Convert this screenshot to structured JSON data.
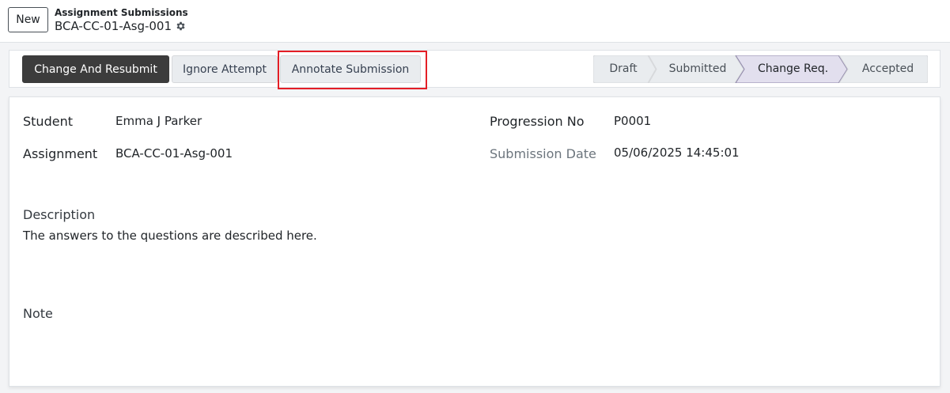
{
  "control_panel": {
    "new_label": "New",
    "breadcrumb_parent": "Assignment Submissions",
    "record_name": "BCA-CC-01-Asg-001"
  },
  "status_bar": {
    "buttons": {
      "change_resubmit": "Change And Resubmit",
      "ignore_attempt": "Ignore Attempt",
      "annotate_submission": "Annotate Submission"
    },
    "stages": [
      "Draft",
      "Submitted",
      "Change Req.",
      "Accepted"
    ],
    "active_stage": "Change Req."
  },
  "form": {
    "student_label": "Student",
    "student_value": "Emma J Parker",
    "assignment_label": "Assignment",
    "assignment_value": "BCA-CC-01-Asg-001",
    "progression_label": "Progression No",
    "progression_value": "P0001",
    "submission_date_label": "Submission Date",
    "submission_date_value": "05/06/2025 14:45:01",
    "description_label": "Description",
    "description_value": "The answers to the questions are described here.",
    "note_label": "Note"
  },
  "colors": {
    "primary_button": "#3c3c3c",
    "active_stage": "#e2dfee",
    "highlight_box": "#e41e26"
  }
}
